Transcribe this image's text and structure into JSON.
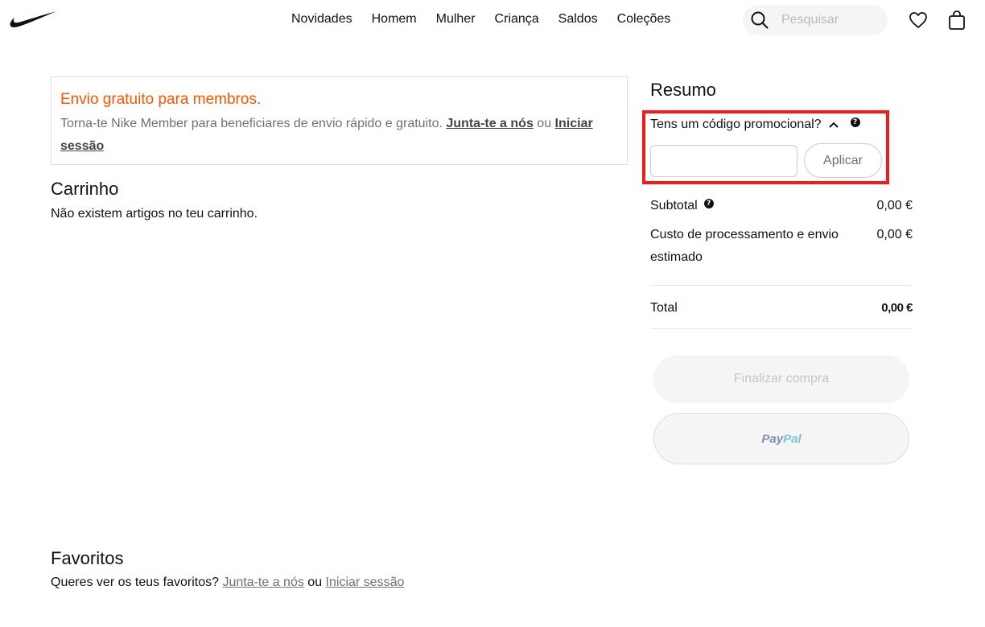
{
  "header": {
    "logo": "nike-swoosh",
    "nav": [
      "Novidades",
      "Homem",
      "Mulher",
      "Criança",
      "Saldos",
      "Coleções"
    ],
    "search_placeholder": "Pesquisar",
    "icons": {
      "search": "search-icon",
      "favorites": "heart-icon",
      "bag": "bag-icon"
    }
  },
  "banner": {
    "title": "Envio gratuito para membros.",
    "text": "Torna-te Nike Member para beneficiares de envio rápido e gratuito.",
    "join_link": "Junta-te a nós",
    "or": "ou",
    "login_link": "Iniciar sessão"
  },
  "cart": {
    "title": "Carrinho",
    "empty_message": "Não existem artigos no teu carrinho."
  },
  "summary": {
    "title": "Resumo",
    "promo_toggle": "Tens um código promocional?",
    "promo_value": "",
    "apply_label": "Aplicar",
    "subtotal_label": "Subtotal",
    "subtotal_value": "0,00 €",
    "shipping_label": "Custo de processamento e envio estimado",
    "shipping_value": "0,00 €",
    "total_label": "Total",
    "total_value": "0,00 €",
    "checkout_label": "Finalizar compra",
    "paypal_part1": "Pay",
    "paypal_part2": "Pal"
  },
  "favorites": {
    "title": "Favoritos",
    "text": "Queres ver os teus favoritos?",
    "join_link": "Junta-te a nós",
    "or": "ou",
    "login_link": "Iniciar sessão"
  },
  "colors": {
    "accent_orange": "#fa5400",
    "highlight_red": "#ee1c1c"
  }
}
